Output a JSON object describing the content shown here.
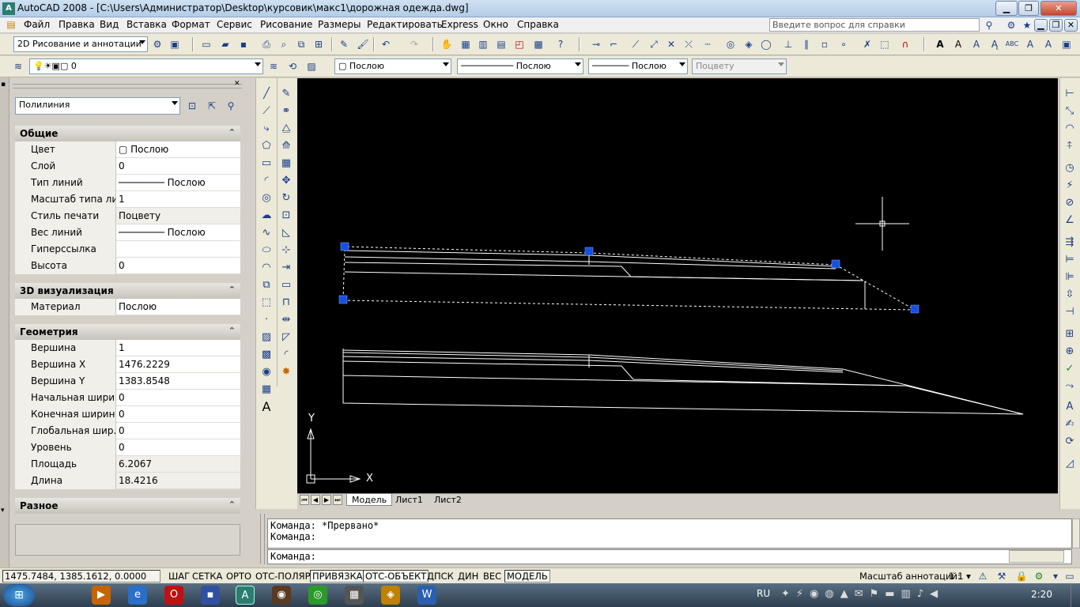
{
  "window": {
    "title": "AutoCAD 2008 - [C:\\Users\\Администратор\\Desktop\\курсовик\\макс1\\дорожная одежда.dwg]"
  },
  "menu": {
    "items": [
      "Файл",
      "Правка",
      "Вид",
      "Вставка",
      "Формат",
      "Сервис",
      "Рисование",
      "Размеры",
      "Редактировать",
      "Express",
      "Окно",
      "Справка"
    ],
    "help_placeholder": "Введите вопрос для справки"
  },
  "toolbar": {
    "workspace": "2D Рисование и аннотации",
    "layer": "0",
    "color": "Послою",
    "linetype": "Послою",
    "lineweight": "Послою",
    "plotstyle": "Поцвету"
  },
  "properties": {
    "object_type": "Полилиния",
    "sections": {
      "general": {
        "title": "Общие",
        "rows": [
          {
            "key": "Цвет",
            "value": "Послою"
          },
          {
            "key": "Слой",
            "value": "0"
          },
          {
            "key": "Тип линий",
            "value": "Послою"
          },
          {
            "key": "Масштаб типа ли...",
            "value": "1"
          },
          {
            "key": "Стиль печати",
            "value": "Поцвету"
          },
          {
            "key": "Вес линий",
            "value": "Послою"
          },
          {
            "key": "Гиперссылка",
            "value": ""
          },
          {
            "key": "Высота",
            "value": "0"
          }
        ]
      },
      "viz3d": {
        "title": "3D визуализация",
        "rows": [
          {
            "key": "Материал",
            "value": "Послою"
          }
        ]
      },
      "geometry": {
        "title": "Геометрия",
        "rows": [
          {
            "key": "Вершина",
            "value": "1"
          },
          {
            "key": "Вершина X",
            "value": "1476.2229"
          },
          {
            "key": "Вершина Y",
            "value": "1383.8548"
          },
          {
            "key": "Начальная шири...",
            "value": "0"
          },
          {
            "key": "Конечная ширин...",
            "value": "0"
          },
          {
            "key": "Глобальная шир...",
            "value": "0"
          },
          {
            "key": "Уровень",
            "value": "0"
          },
          {
            "key": "Площадь",
            "value": "6.2067"
          },
          {
            "key": "Длина",
            "value": "18.4216"
          }
        ]
      },
      "misc": {
        "title": "Разное"
      }
    }
  },
  "ucs": {
    "x_label": "X",
    "y_label": "Y"
  },
  "tabs": [
    "Модель",
    "Лист1",
    "Лист2"
  ],
  "command": {
    "lines": [
      "Команда: *Прервано*",
      "Команда:"
    ],
    "prompt": "Команда:"
  },
  "status": {
    "coords": "1475.7484, 1385.1612, 0.0000",
    "buttons": [
      {
        "label": "ШАГ",
        "on": false
      },
      {
        "label": "СЕТКА",
        "on": false
      },
      {
        "label": "ОРТО",
        "on": false
      },
      {
        "label": "ОТС-ПОЛЯР",
        "on": false
      },
      {
        "label": "ПРИВЯЗКА",
        "on": true
      },
      {
        "label": "ОТС-ОБЪЕКТ",
        "on": true
      },
      {
        "label": "ДПСК",
        "on": false
      },
      {
        "label": "ДИН",
        "on": false
      },
      {
        "label": "ВЕС",
        "on": false
      },
      {
        "label": "МОДЕЛЬ",
        "on": true
      }
    ],
    "annotation_scale_label": "Масштаб аннотаций:",
    "annotation_scale": "1:1"
  },
  "taskbar": {
    "lang": "RU",
    "time": "2:20"
  }
}
